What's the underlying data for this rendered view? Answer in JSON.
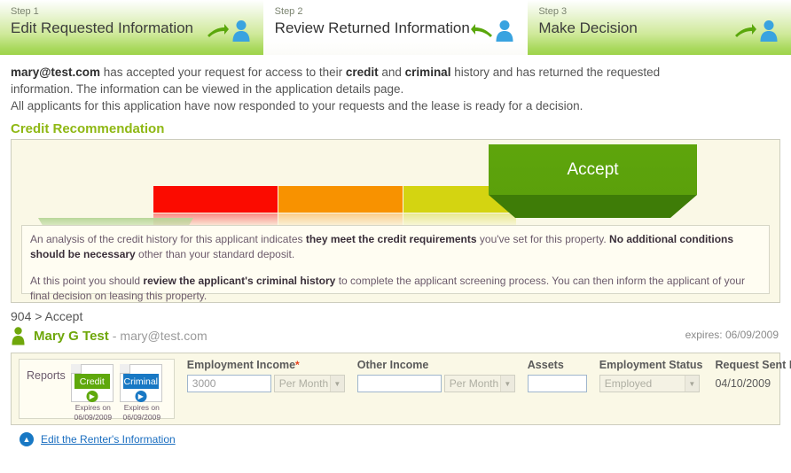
{
  "steps": [
    {
      "number": "Step 1",
      "title": "Edit Requested Information",
      "arrow": "arrow-right-icon",
      "person": "person-icon",
      "active": false
    },
    {
      "number": "Step 2",
      "title": "Review Returned Information",
      "arrow": "arrow-left-icon",
      "person": "person-icon",
      "active": true
    },
    {
      "number": "Step 3",
      "title": "Make Decision",
      "arrow": "arrow-right-icon",
      "person": "person-icon",
      "active": false
    }
  ],
  "intro": {
    "email": "mary@test.com",
    "l1a": " has accepted your request for access to their ",
    "bold_credit": "credit",
    "l1b": " and ",
    "bold_criminal": "criminal",
    "l1c": " history and has returned the requested",
    "line2": "information. The information can be viewed in the application details page.",
    "line3": "All applicants for this application have now responded to your requests and the lease is ready for a decision."
  },
  "section": {
    "heading": "Credit Recommendation"
  },
  "gauge": {
    "accept_label": "Accept",
    "segments": [
      {
        "name": "reject",
        "color": "#fb0b00"
      },
      {
        "name": "caution-high",
        "color": "#f89200"
      },
      {
        "name": "caution-low",
        "color": "#d4d411"
      },
      {
        "name": "accept",
        "color": "#5ba00b"
      }
    ]
  },
  "analysis": {
    "p1_a": "An analysis of the credit history for this applicant indicates ",
    "p1_b": "they meet the credit requirements",
    "p1_c": " you've set for this property.  ",
    "p1_d": "No additional conditions should be necessary",
    "p1_e": " other than your standard deposit.",
    "p2_a": "At this point you should ",
    "p2_b": "review the applicant's criminal history",
    "p2_c": " to complete the applicant screening process. You can then inform the applicant of your final decision on leasing this property."
  },
  "applicant": {
    "id_line": "904 > Accept",
    "avatar": "person-icon",
    "name": "Mary G Test",
    "separator": "-",
    "email": "mary@test.com",
    "expires_label": "expires:",
    "expires_date": "06/09/2009"
  },
  "reports": {
    "label": "Reports",
    "cards": [
      {
        "title": "Credit",
        "expires_label": "Expires on",
        "expires_date": "06/09/2009",
        "go_icon": "chevron-right-icon",
        "color": "#5fa80c"
      },
      {
        "title": "Criminal",
        "expires_label": "Expires on",
        "expires_date": "06/09/2009",
        "go_icon": "chevron-right-icon",
        "color": "#1878c4"
      }
    ]
  },
  "form": {
    "employment_income": {
      "label": "Employment Income",
      "required_mark": "*",
      "value": "3000",
      "period": "Per Month"
    },
    "other_income": {
      "label": "Other Income",
      "value": "",
      "placeholder": "",
      "period": "Per Month"
    },
    "assets": {
      "label": "Assets",
      "value": "",
      "placeholder": ""
    },
    "employment_status": {
      "label": "Employment Status",
      "value": "Employed"
    },
    "request_sent_date": {
      "label": "Request Sent Date",
      "value": "04/10/2009"
    }
  },
  "footer": {
    "icon": "chevron-up-circle-icon",
    "link": "Edit the Renter's Information"
  }
}
